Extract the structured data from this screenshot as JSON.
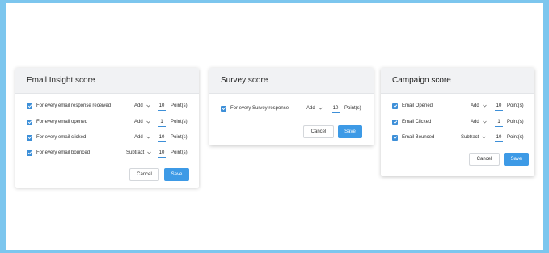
{
  "cards": [
    {
      "title": "Email Insight score",
      "rows": [
        {
          "label": "For every email response received",
          "op": "Add",
          "value": "10",
          "unit": "Point(s)"
        },
        {
          "label": "For every email opened",
          "op": "Add",
          "value": "1",
          "unit": "Point(s)"
        },
        {
          "label": "For every email clicked",
          "op": "Add",
          "value": "10",
          "unit": "Point(s)"
        },
        {
          "label": "For every email bounced",
          "op": "Subtract",
          "value": "10",
          "unit": "Point(s)"
        }
      ],
      "cancel_label": "Cancel",
      "save_label": "Save"
    },
    {
      "title": "Survey score",
      "rows": [
        {
          "label": "For every Survey response",
          "op": "Add",
          "value": "10",
          "unit": "Point(s)"
        }
      ],
      "cancel_label": "Cancel",
      "save_label": "Save"
    },
    {
      "title": "Campaign score",
      "rows": [
        {
          "label": "Email Opened",
          "op": "Add",
          "value": "10",
          "unit": "Point(s)"
        },
        {
          "label": "Email Clicked",
          "op": "Add",
          "value": "1",
          "unit": "Point(s)"
        },
        {
          "label": "Email Bounced",
          "op": "Subtract",
          "value": "10",
          "unit": "Point(s)"
        }
      ],
      "cancel_label": "Cancel",
      "save_label": "Save"
    }
  ],
  "colors": {
    "accent": "#3d8fd8",
    "save_button": "#3d9ae6",
    "frame": "#7cc6ee",
    "header_bg": "#f1f2f4"
  },
  "icons": {
    "checkbox": "checkmark-icon",
    "dropdown": "chevron-down-icon"
  }
}
